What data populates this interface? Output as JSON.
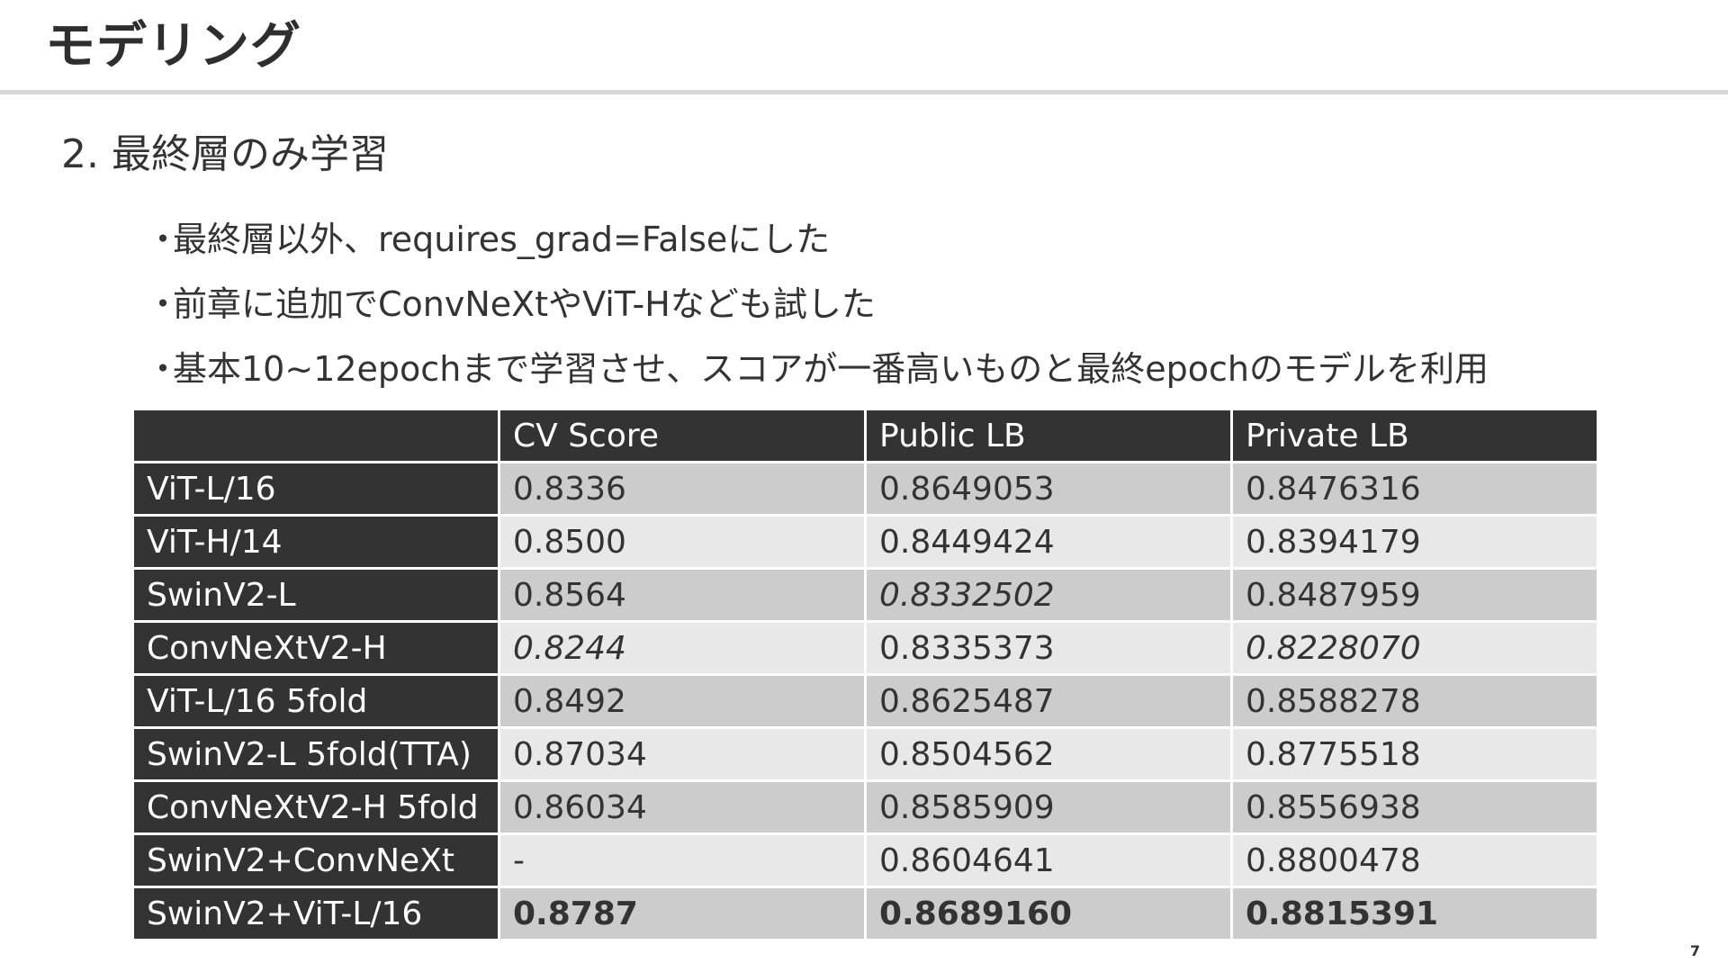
{
  "slide": {
    "title": "モデリング",
    "section_heading": "2. 最終層のみ学習",
    "page_number": "7"
  },
  "bullets": [
    {
      "marker": "・",
      "text": "最終層以外、requires_grad=Falseにした"
    },
    {
      "marker": "・",
      "text": "前章に追加でConvNeXtやViT-Hなども試した"
    },
    {
      "marker": "・",
      "text": "基本10~12epochまで学習させ、スコアが一番高いものと最終epochのモデルを利用"
    }
  ],
  "table": {
    "headers": [
      "",
      "CV Score",
      "Public LB",
      "Private LB"
    ],
    "rows": [
      {
        "model": "ViT-L/16",
        "cv": "0.8336",
        "public": "0.8649053",
        "private": "0.8476316",
        "cv_style": "",
        "public_style": "",
        "private_style": ""
      },
      {
        "model": "ViT-H/14",
        "cv": "0.8500",
        "public": "0.8449424",
        "private": "0.8394179",
        "cv_style": "",
        "public_style": "",
        "private_style": ""
      },
      {
        "model": "SwinV2-L",
        "cv": "0.8564",
        "public": "0.8332502",
        "private": "0.8487959",
        "cv_style": "",
        "public_style": "italic",
        "private_style": ""
      },
      {
        "model": "ConvNeXtV2-H",
        "cv": "0.8244",
        "public": "0.8335373",
        "private": "0.8228070",
        "cv_style": "italic",
        "public_style": "",
        "private_style": "italic"
      },
      {
        "model": "ViT-L/16 5fold",
        "cv": "0.8492",
        "public": "0.8625487",
        "private": "0.8588278",
        "cv_style": "",
        "public_style": "",
        "private_style": ""
      },
      {
        "model": "SwinV2-L 5fold(TTA)",
        "cv": "0.87034",
        "public": "0.8504562",
        "private": "0.8775518",
        "cv_style": "",
        "public_style": "",
        "private_style": ""
      },
      {
        "model": "ConvNeXtV2-H 5fold",
        "cv": "0.86034",
        "public": "0.8585909",
        "private": "0.8556938",
        "cv_style": "",
        "public_style": "",
        "private_style": ""
      },
      {
        "model": "SwinV2+ConvNeXt",
        "cv": "-",
        "public": "0.8604641",
        "private": "0.8800478",
        "cv_style": "",
        "public_style": "",
        "private_style": ""
      },
      {
        "model": "SwinV2+ViT-L/16",
        "cv": "0.8787",
        "public": "0.8689160",
        "private": "0.8815391",
        "cv_style": "bold",
        "public_style": "bold",
        "private_style": "bold"
      }
    ]
  },
  "colors": {
    "header_bg": "#333333",
    "row_odd_bg": "#cccccc",
    "row_even_bg": "#e8e8e8",
    "rule": "#d6d6d6"
  }
}
